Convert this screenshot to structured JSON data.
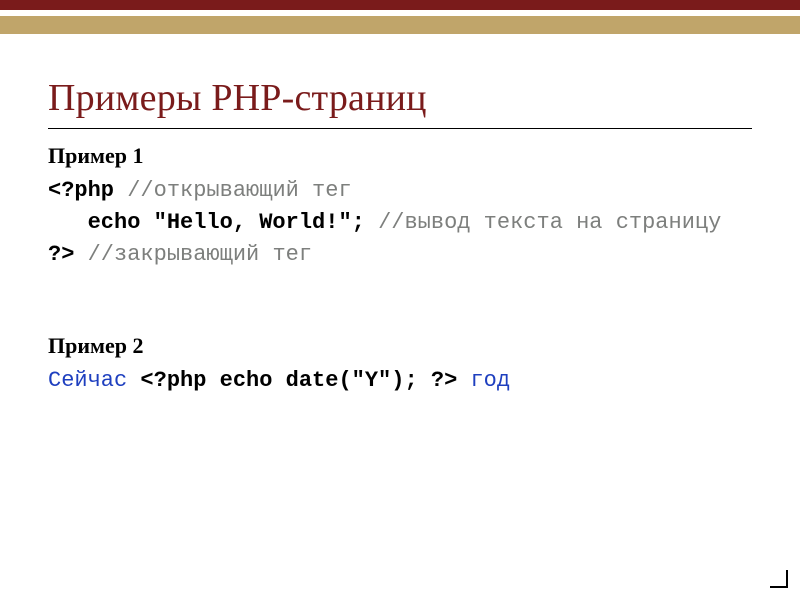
{
  "decor": {
    "dark": "#7a1b1b",
    "light": "#c0a56a"
  },
  "title": "Примеры PHP-страниц",
  "example1": {
    "heading": "Пример 1",
    "l1_kw": "<?php ",
    "l1_cm": "//открывающий тег",
    "l2_kw": "   echo \"Hello, World!\"; ",
    "l2_cm": "//вывод текста на страницу",
    "l3_kw": "?> ",
    "l3_cm": "//закрывающий тег"
  },
  "example2": {
    "heading": "Пример 2",
    "l1_pre": "Сейчас ",
    "l1_kw": "<?php echo date(\"Y\"); ?>",
    "l1_post": " год"
  }
}
